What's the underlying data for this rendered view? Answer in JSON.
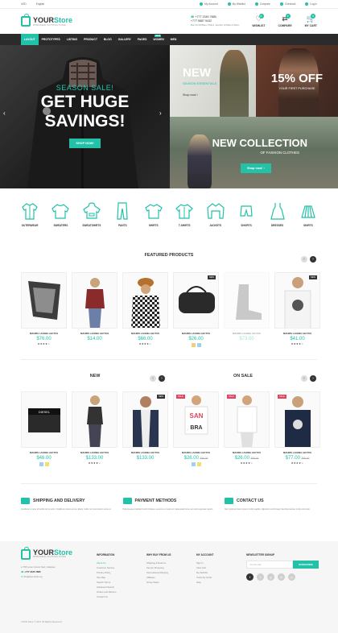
{
  "topbar": {
    "currency": "USD",
    "language": "English",
    "links": [
      "My Account",
      "My Wishlist",
      "Compare",
      "Checkout",
      "Log in"
    ]
  },
  "header": {
    "logo_main": "YOUR",
    "logo_accent": "Store",
    "logo_tagline": "WORKWEAR CLOTHING STORE",
    "phone1": "+777 2345 7885;",
    "phone2": "+777 5887 5432",
    "hours": "Mon-Fri 09:00am-7:00pm, Sat-Sun 10:00am-6:00pm",
    "wishlist_label": "WISHLIST",
    "wishlist_count": "0",
    "compare_label": "COMPARE",
    "compare_count": "0",
    "cart_label": "MY CART",
    "cart_count": "0"
  },
  "nav": {
    "items": [
      "LAYOUT",
      "PROTOTYPES",
      "LISTING",
      "PRODUCT",
      "BLOG",
      "GALLERY",
      "PAGES",
      "WOMEN",
      "MEN"
    ],
    "new_badge": "NEW",
    "active_index": 0
  },
  "hero": {
    "main_kicker": "SEASON SALE!",
    "main_line1": "GET HUGE",
    "main_line2": "SAVINGS!",
    "main_button": "SHOP NOW!",
    "banner1_title": "NEW",
    "banner1_sub": "SEASON ESSENTIALS",
    "banner1_link": "Shop now! ›",
    "banner2_title": "15% OFF",
    "banner2_sub": "YOUR FIRST PURCHASE",
    "banner3_title": "NEW COLLECTION",
    "banner3_sub": "OF FASHION CLOTHES",
    "banner3_button": "Shop now! ›"
  },
  "categories": [
    "OUTERWEAR",
    "SWEATERS",
    "SWEATSHIRTS",
    "PANTS",
    "SHIRTS",
    "T-SHIRTS",
    "JACKETS",
    "SHORTS",
    "DRESSES",
    "SKIRTS"
  ],
  "featured": {
    "title": "FEATURED PRODUCTS",
    "products": [
      {
        "name": "MAURIS LACINIA LECTUS",
        "price": "$76.00",
        "badge": ""
      },
      {
        "name": "MAURIS LACINIA LECTUS",
        "price": "$14.00",
        "badge": ""
      },
      {
        "name": "MAURIS LACINIA LECTUS",
        "price": "$66.00",
        "badge": ""
      },
      {
        "name": "MAURIS LACINIA LECTUS",
        "price": "$26.00",
        "badge": "NEW"
      },
      {
        "name": "MAURIS LACINIA LECTUS",
        "price": "$73.00",
        "badge": ""
      },
      {
        "name": "MAURIS LACINIA LECTUS",
        "price": "$41.00",
        "badge": "NEW"
      }
    ]
  },
  "new_section": {
    "title": "NEW",
    "products": [
      {
        "name": "MAURIS LACINIA LECTUS",
        "price": "$46.00",
        "old": "",
        "badge": ""
      },
      {
        "name": "MAURIS LACINIA LECTUS",
        "price": "$133.00",
        "old": "",
        "badge": ""
      },
      {
        "name": "MAURIS LACINIA LECTUS",
        "price": "$133.00",
        "old": "",
        "badge": "NEW"
      }
    ]
  },
  "sale_section": {
    "title": "ON SALE",
    "products": [
      {
        "name": "MAURIS LACINIA LECTUS",
        "price": "$26.00",
        "old": "$36.00",
        "badge": "SALE"
      },
      {
        "name": "MAURIS LACINIA LECTUS",
        "price": "$26.00",
        "old": "$38.00",
        "badge": "SALE"
      },
      {
        "name": "MAURIS LACINIA LECTUS",
        "price": "$77.00",
        "old": "$89.00",
        "badge": "SALE"
      }
    ]
  },
  "stars": "★★★★☆",
  "info": [
    {
      "title": "SHIPPING AND DELIVERY",
      "text": "Vestibulum curae id facilisi dui ut enim, fringilla at viverra purus. Etiam mollis non nisi pretium amet et."
    },
    {
      "title": "PAYMENT METHODS",
      "text": "Pellentesque habitant morbi tristique senectus et netus et malesuada fames ac turpis egestas mauris."
    },
    {
      "title": "CONTACT US",
      "text": "Nam pulvinar lorem ipsum mollis sagittis, dignissim velit integer faucibus laoreet nulla commodo."
    }
  ],
  "footer": {
    "col1": [
      "795 Lorem Ipsum Sed, Glasgow",
      "+777 2345 7885",
      "info@demolink.org"
    ],
    "info_title": "INFORMATION",
    "info_links": [
      "About Us",
      "Customer Service",
      "Privacy Policy",
      "Site Map",
      "Search Terms",
      "Advanced Search",
      "Orders and Returns",
      "Contact Us"
    ],
    "why_title": "WHY BUY FROM US",
    "why_links": [
      "Shipping & Returns",
      "Secure Shopping",
      "International Shipping",
      "Affiliates",
      "Group Sales"
    ],
    "acc_title": "MY ACCOUNT",
    "acc_links": [
      "Sign In",
      "View Cart",
      "My Wishlist",
      "Track My Order",
      "Help"
    ],
    "news_title": "NEWSLETTER SIGNUP",
    "news_placeholder": "Your E-mail",
    "news_button": "SUBSCRIBE",
    "social": [
      "f",
      "t",
      "g",
      "in",
      "p"
    ],
    "copyright": "YOUR Store © 2017 All Rights Reserved"
  }
}
